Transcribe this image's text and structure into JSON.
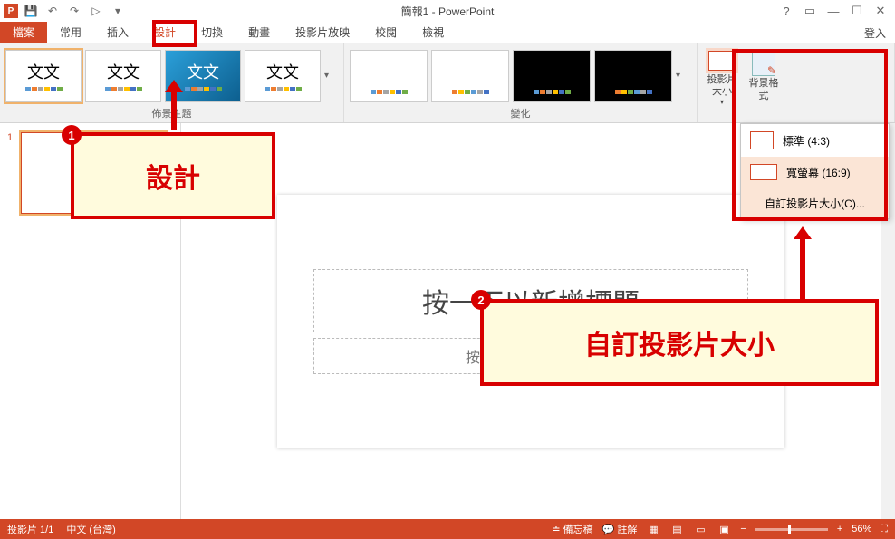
{
  "title": "簡報1 - PowerPoint",
  "login": "登入",
  "tabs": {
    "file": "檔案",
    "home": "常用",
    "insert": "插入",
    "design": "設計",
    "transition": "切換",
    "animation": "動畫",
    "slideshow": "投影片放映",
    "review": "校閱",
    "view": "檢視"
  },
  "ribbon": {
    "theme_sample": "文文",
    "group_themes": "佈景主題",
    "group_variants": "變化",
    "slide_size": "投影片大小",
    "bg_format": "背景格式"
  },
  "size_menu": {
    "standard": "標準 (4:3)",
    "wide": "寬螢幕 (16:9)",
    "custom": "自訂投影片大小(C)..."
  },
  "slide": {
    "number": "1",
    "title_ph": "按一下以新增標題",
    "sub_ph": "按一下以新增副標題"
  },
  "status": {
    "slide_count": "投影片 1/1",
    "lang": "中文 (台灣)",
    "notes": "備忘稿",
    "comments": "註解",
    "zoom": "56%"
  },
  "callouts": {
    "design": "設計",
    "custom_size": "自訂投影片大小"
  }
}
